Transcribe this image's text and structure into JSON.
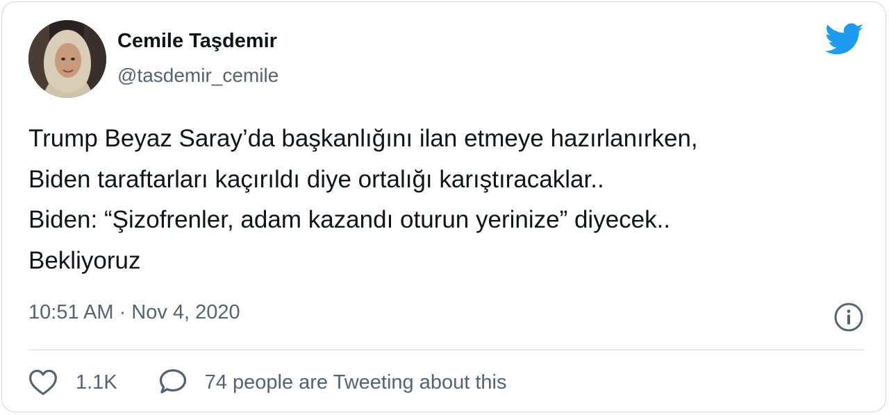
{
  "author": {
    "name": "Cemile Taşdemir",
    "handle": "@tasdemir_cemile",
    "avatar_icon": "avatar-photo"
  },
  "brand": {
    "icon": "twitter-bird-icon",
    "color": "#1d9bf0"
  },
  "tweet": {
    "lines": [
      "Trump Beyaz Saray’da başkanlığını ilan etmeye hazırlanırken,",
      "Biden taraftarları kaçırıldı diye ortalığı karıştıracaklar..",
      "Biden: “Şizofrenler, adam kazandı oturun yerinize” diyecek..",
      "Bekliyoruz"
    ],
    "timestamp": "10:51 AM · Nov 4, 2020"
  },
  "actions": {
    "like_count": "1.1K",
    "reply_text": "74 people are Tweeting about this"
  },
  "colors": {
    "text": "#0f1419",
    "secondary": "#536471",
    "border": "#cfd9de"
  }
}
